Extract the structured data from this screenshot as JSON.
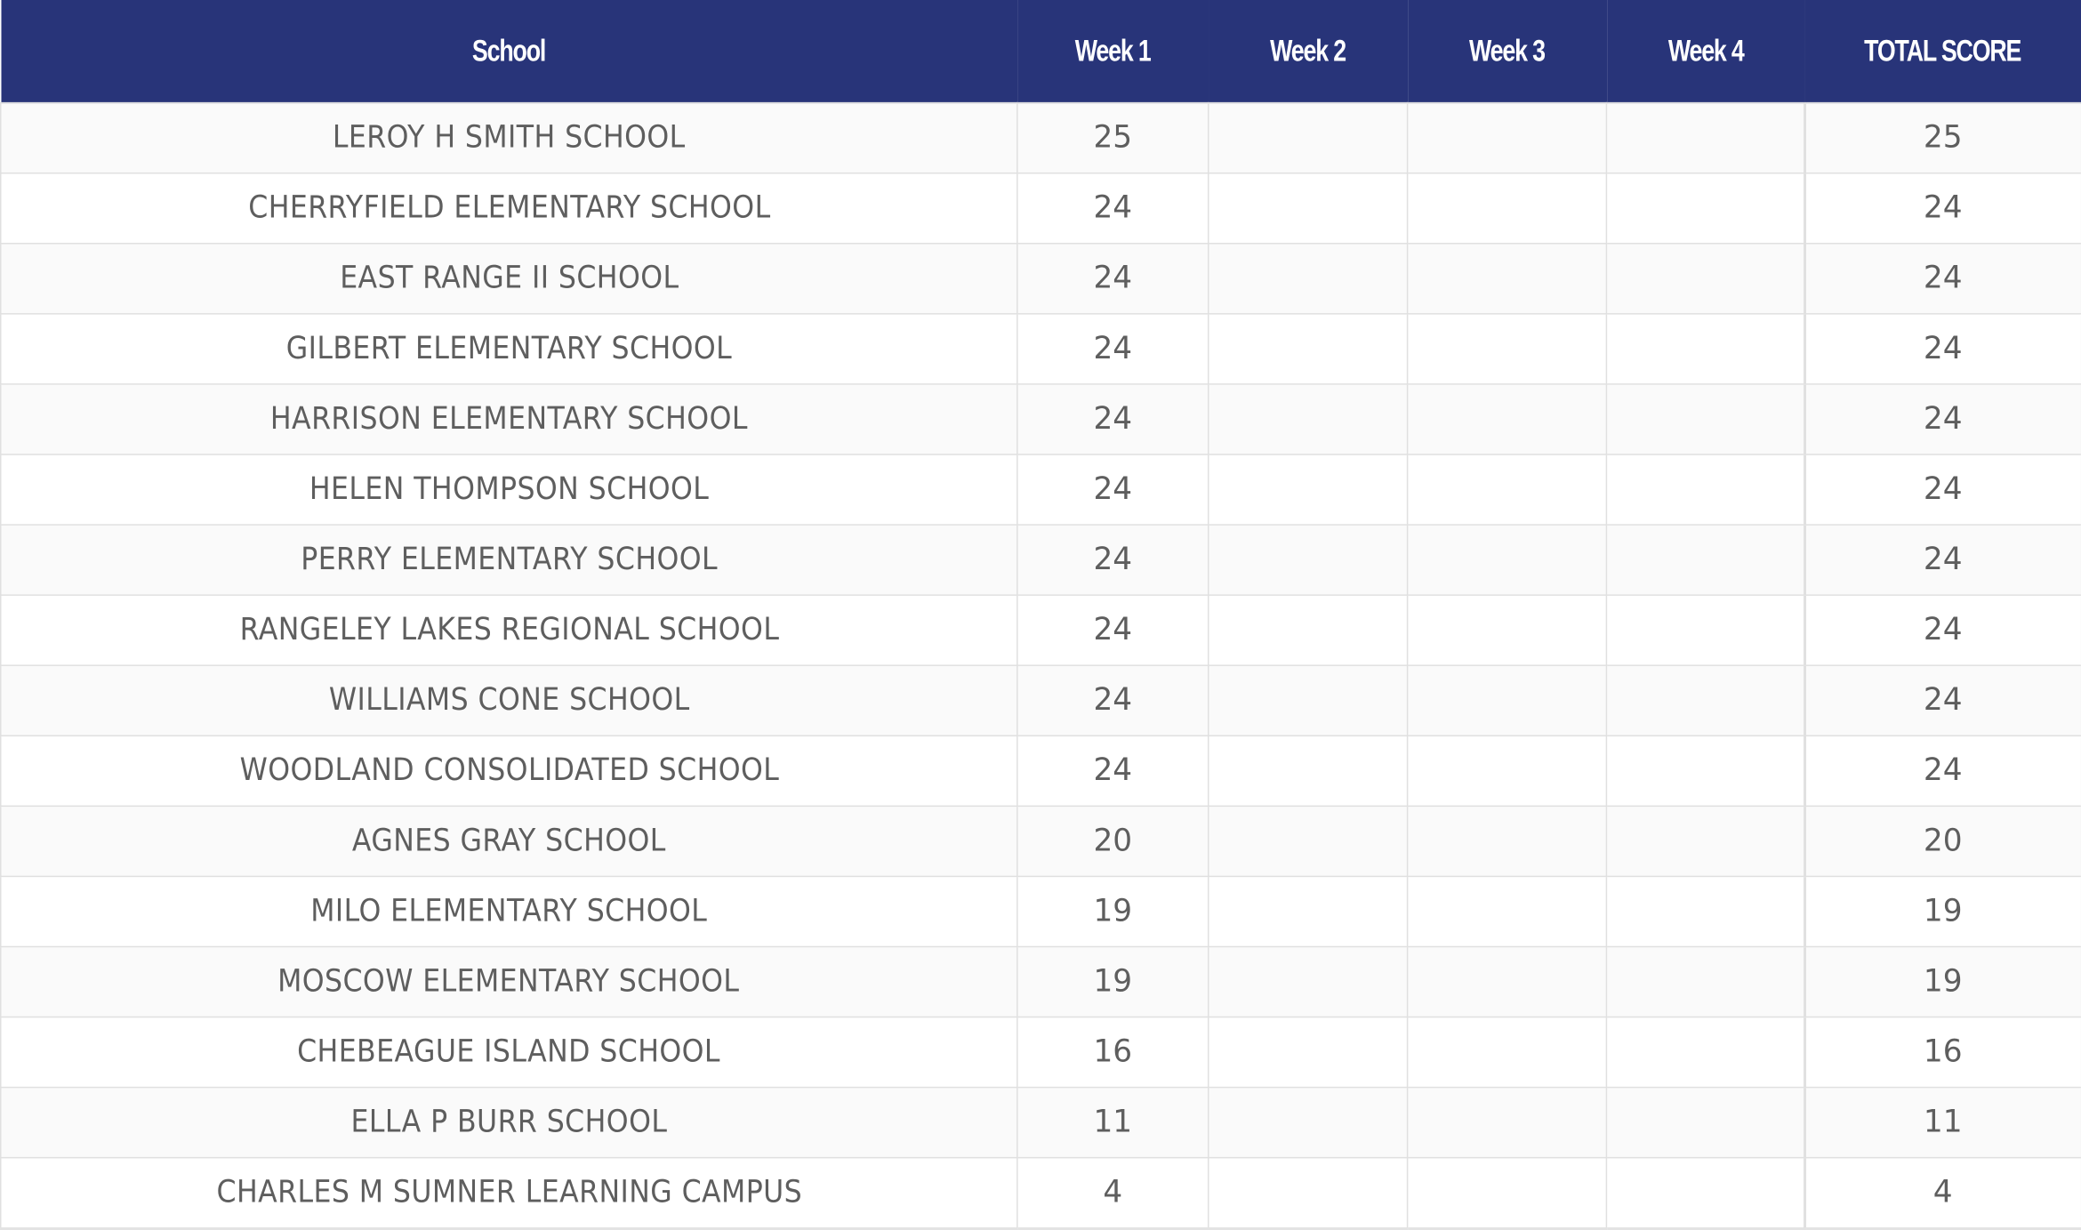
{
  "table": {
    "headers": [
      "School",
      "Week 1",
      "Week 2",
      "Week 3",
      "Week 4",
      "TOTAL SCORE"
    ],
    "rows": [
      {
        "school": "LEROY H SMITH SCHOOL",
        "week1": "25",
        "week2": "",
        "week3": "",
        "week4": "",
        "total": "25"
      },
      {
        "school": "CHERRYFIELD ELEMENTARY SCHOOL",
        "week1": "24",
        "week2": "",
        "week3": "",
        "week4": "",
        "total": "24"
      },
      {
        "school": "EAST RANGE II SCHOOL",
        "week1": "24",
        "week2": "",
        "week3": "",
        "week4": "",
        "total": "24"
      },
      {
        "school": "GILBERT ELEMENTARY SCHOOL",
        "week1": "24",
        "week2": "",
        "week3": "",
        "week4": "",
        "total": "24"
      },
      {
        "school": "HARRISON ELEMENTARY SCHOOL",
        "week1": "24",
        "week2": "",
        "week3": "",
        "week4": "",
        "total": "24"
      },
      {
        "school": "HELEN THOMPSON SCHOOL",
        "week1": "24",
        "week2": "",
        "week3": "",
        "week4": "",
        "total": "24"
      },
      {
        "school": "PERRY ELEMENTARY SCHOOL",
        "week1": "24",
        "week2": "",
        "week3": "",
        "week4": "",
        "total": "24"
      },
      {
        "school": "RANGELEY LAKES REGIONAL SCHOOL",
        "week1": "24",
        "week2": "",
        "week3": "",
        "week4": "",
        "total": "24"
      },
      {
        "school": "WILLIAMS CONE SCHOOL",
        "week1": "24",
        "week2": "",
        "week3": "",
        "week4": "",
        "total": "24"
      },
      {
        "school": "WOODLAND CONSOLIDATED SCHOOL",
        "week1": "24",
        "week2": "",
        "week3": "",
        "week4": "",
        "total": "24"
      },
      {
        "school": "AGNES GRAY SCHOOL",
        "week1": "20",
        "week2": "",
        "week3": "",
        "week4": "",
        "total": "20"
      },
      {
        "school": "MILO ELEMENTARY SCHOOL",
        "week1": "19",
        "week2": "",
        "week3": "",
        "week4": "",
        "total": "19"
      },
      {
        "school": "MOSCOW ELEMENTARY SCHOOL",
        "week1": "19",
        "week2": "",
        "week3": "",
        "week4": "",
        "total": "19"
      },
      {
        "school": "CHEBEAGUE ISLAND SCHOOL",
        "week1": "16",
        "week2": "",
        "week3": "",
        "week4": "",
        "total": "16"
      },
      {
        "school": "ELLA P BURR SCHOOL",
        "week1": "11",
        "week2": "",
        "week3": "",
        "week4": "",
        "total": "11"
      },
      {
        "school": "CHARLES M SUMNER LEARNING CAMPUS",
        "week1": "4",
        "week2": "",
        "week3": "",
        "week4": "",
        "total": "4"
      }
    ]
  },
  "colors": {
    "header_bg": "#283479",
    "header_text": "#ffffff",
    "cell_text": "#5e5e5e",
    "row_alt_bg": "#fafafa",
    "border": "#e0e0e0"
  }
}
